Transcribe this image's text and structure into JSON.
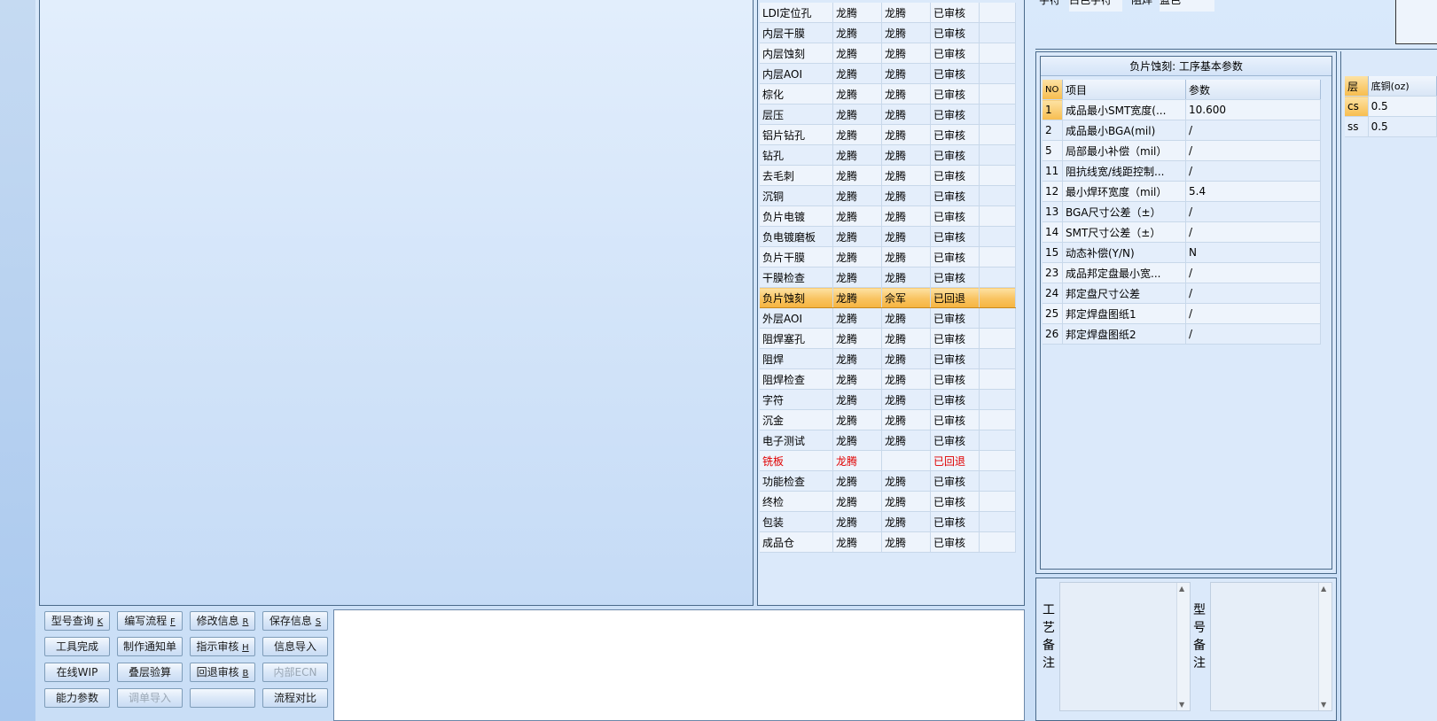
{
  "process_table": {
    "rows": [
      {
        "name": "LDI定位孔",
        "a": "龙腾",
        "b": "龙腾",
        "status": "已审核",
        "state": "normal"
      },
      {
        "name": "内层干膜",
        "a": "龙腾",
        "b": "龙腾",
        "status": "已审核",
        "state": "normal"
      },
      {
        "name": "内层蚀刻",
        "a": "龙腾",
        "b": "龙腾",
        "status": "已审核",
        "state": "normal"
      },
      {
        "name": "内层AOI",
        "a": "龙腾",
        "b": "龙腾",
        "status": "已审核",
        "state": "normal"
      },
      {
        "name": "棕化",
        "a": "龙腾",
        "b": "龙腾",
        "status": "已审核",
        "state": "normal"
      },
      {
        "name": "层压",
        "a": "龙腾",
        "b": "龙腾",
        "status": "已审核",
        "state": "normal"
      },
      {
        "name": "铝片钻孔",
        "a": "龙腾",
        "b": "龙腾",
        "status": "已审核",
        "state": "normal"
      },
      {
        "name": "钻孔",
        "a": "龙腾",
        "b": "龙腾",
        "status": "已审核",
        "state": "normal"
      },
      {
        "name": "去毛刺",
        "a": "龙腾",
        "b": "龙腾",
        "status": "已审核",
        "state": "normal"
      },
      {
        "name": "沉铜",
        "a": "龙腾",
        "b": "龙腾",
        "status": "已审核",
        "state": "normal"
      },
      {
        "name": "负片电镀",
        "a": "龙腾",
        "b": "龙腾",
        "status": "已审核",
        "state": "normal"
      },
      {
        "name": "负电镀磨板",
        "a": "龙腾",
        "b": "龙腾",
        "status": "已审核",
        "state": "normal"
      },
      {
        "name": "负片干膜",
        "a": "龙腾",
        "b": "龙腾",
        "status": "已审核",
        "state": "normal"
      },
      {
        "name": "干膜检查",
        "a": "龙腾",
        "b": "龙腾",
        "status": "已审核",
        "state": "normal"
      },
      {
        "name": "负片蚀刻",
        "a": "龙腾",
        "b": "佘军",
        "status": "已回退",
        "state": "selected"
      },
      {
        "name": "外层AOI",
        "a": "龙腾",
        "b": "龙腾",
        "status": "已审核",
        "state": "normal"
      },
      {
        "name": "阻焊塞孔",
        "a": "龙腾",
        "b": "龙腾",
        "status": "已审核",
        "state": "normal"
      },
      {
        "name": "阻焊",
        "a": "龙腾",
        "b": "龙腾",
        "status": "已审核",
        "state": "normal"
      },
      {
        "name": "阻焊检查",
        "a": "龙腾",
        "b": "龙腾",
        "status": "已审核",
        "state": "normal"
      },
      {
        "name": "字符",
        "a": "龙腾",
        "b": "龙腾",
        "status": "已审核",
        "state": "normal"
      },
      {
        "name": "沉金",
        "a": "龙腾",
        "b": "龙腾",
        "status": "已审核",
        "state": "normal"
      },
      {
        "name": "电子测试",
        "a": "龙腾",
        "b": "龙腾",
        "status": "已审核",
        "state": "normal"
      },
      {
        "name": "铣板",
        "a": "龙腾",
        "b": "",
        "status": "已回退",
        "state": "red"
      },
      {
        "name": "功能检查",
        "a": "龙腾",
        "b": "龙腾",
        "status": "已审核",
        "state": "normal"
      },
      {
        "name": "终检",
        "a": "龙腾",
        "b": "龙腾",
        "status": "已审核",
        "state": "normal"
      },
      {
        "name": "包装",
        "a": "龙腾",
        "b": "龙腾",
        "status": "已审核",
        "state": "normal"
      },
      {
        "name": "成品仓",
        "a": "龙腾",
        "b": "龙腾",
        "status": "已审核",
        "state": "normal"
      }
    ]
  },
  "top_right": {
    "label1": "字符",
    "value1": "白色字符",
    "label2": "阻焊",
    "value2": "蓝色"
  },
  "params": {
    "title": "负片蚀刻: 工序基本参数",
    "headers": {
      "no": "NO",
      "item": "项目",
      "param": "参数"
    },
    "rows": [
      {
        "no": "1",
        "item": "成品最小SMT宽度(...",
        "param": "10.600"
      },
      {
        "no": "2",
        "item": "成品最小BGA(mil)",
        "param": "/"
      },
      {
        "no": "5",
        "item": "局部最小补偿（mil）",
        "param": "/"
      },
      {
        "no": "11",
        "item": "阻抗线宽/线距控制...",
        "param": "/"
      },
      {
        "no": "12",
        "item": "最小焊环宽度（mil）",
        "param": "5.4"
      },
      {
        "no": "13",
        "item": "BGA尺寸公差（±）",
        "param": "/"
      },
      {
        "no": "14",
        "item": "SMT尺寸公差（±）",
        "param": "/"
      },
      {
        "no": "15",
        "item": "动态补偿(Y/N)",
        "param": "N"
      },
      {
        "no": "23",
        "item": "成品邦定盘最小宽...",
        "param": "/"
      },
      {
        "no": "24",
        "item": "邦定盘尺寸公差",
        "param": "/"
      },
      {
        "no": "25",
        "item": "邦定焊盘图纸1",
        "param": "/"
      },
      {
        "no": "26",
        "item": "邦定焊盘图纸2",
        "param": "/"
      }
    ]
  },
  "copper": {
    "headers": {
      "layer": "层",
      "base": "底铜(oz)"
    },
    "rows": [
      {
        "layer": "cs",
        "base": "0.5"
      },
      {
        "layer": "ss",
        "base": "0.5"
      }
    ]
  },
  "remarks": {
    "process_label": "工艺备注",
    "model_label": "型号备注"
  },
  "buttons": [
    {
      "label": "型号查询",
      "key": "K",
      "disabled": false
    },
    {
      "label": "编写流程",
      "key": "F",
      "disabled": false
    },
    {
      "label": "修改信息",
      "key": "R",
      "disabled": false
    },
    {
      "label": "保存信息",
      "key": "S",
      "disabled": false
    },
    {
      "label": "工具完成",
      "key": "",
      "disabled": false
    },
    {
      "label": "制作通知单",
      "key": "",
      "disabled": false
    },
    {
      "label": "指示审核",
      "key": "H",
      "disabled": false
    },
    {
      "label": "信息导入",
      "key": "",
      "disabled": false
    },
    {
      "label": "在线WIP",
      "key": "",
      "disabled": false
    },
    {
      "label": "叠层验算",
      "key": "",
      "disabled": false
    },
    {
      "label": "回退审核",
      "key": "B",
      "disabled": false
    },
    {
      "label": "内部ECN",
      "key": "",
      "disabled": true
    },
    {
      "label": "能力参数",
      "key": "",
      "disabled": false
    },
    {
      "label": "调单导入",
      "key": "",
      "disabled": true
    },
    {
      "label": "",
      "key": "",
      "disabled": false
    },
    {
      "label": "流程对比",
      "key": "",
      "disabled": false
    }
  ]
}
